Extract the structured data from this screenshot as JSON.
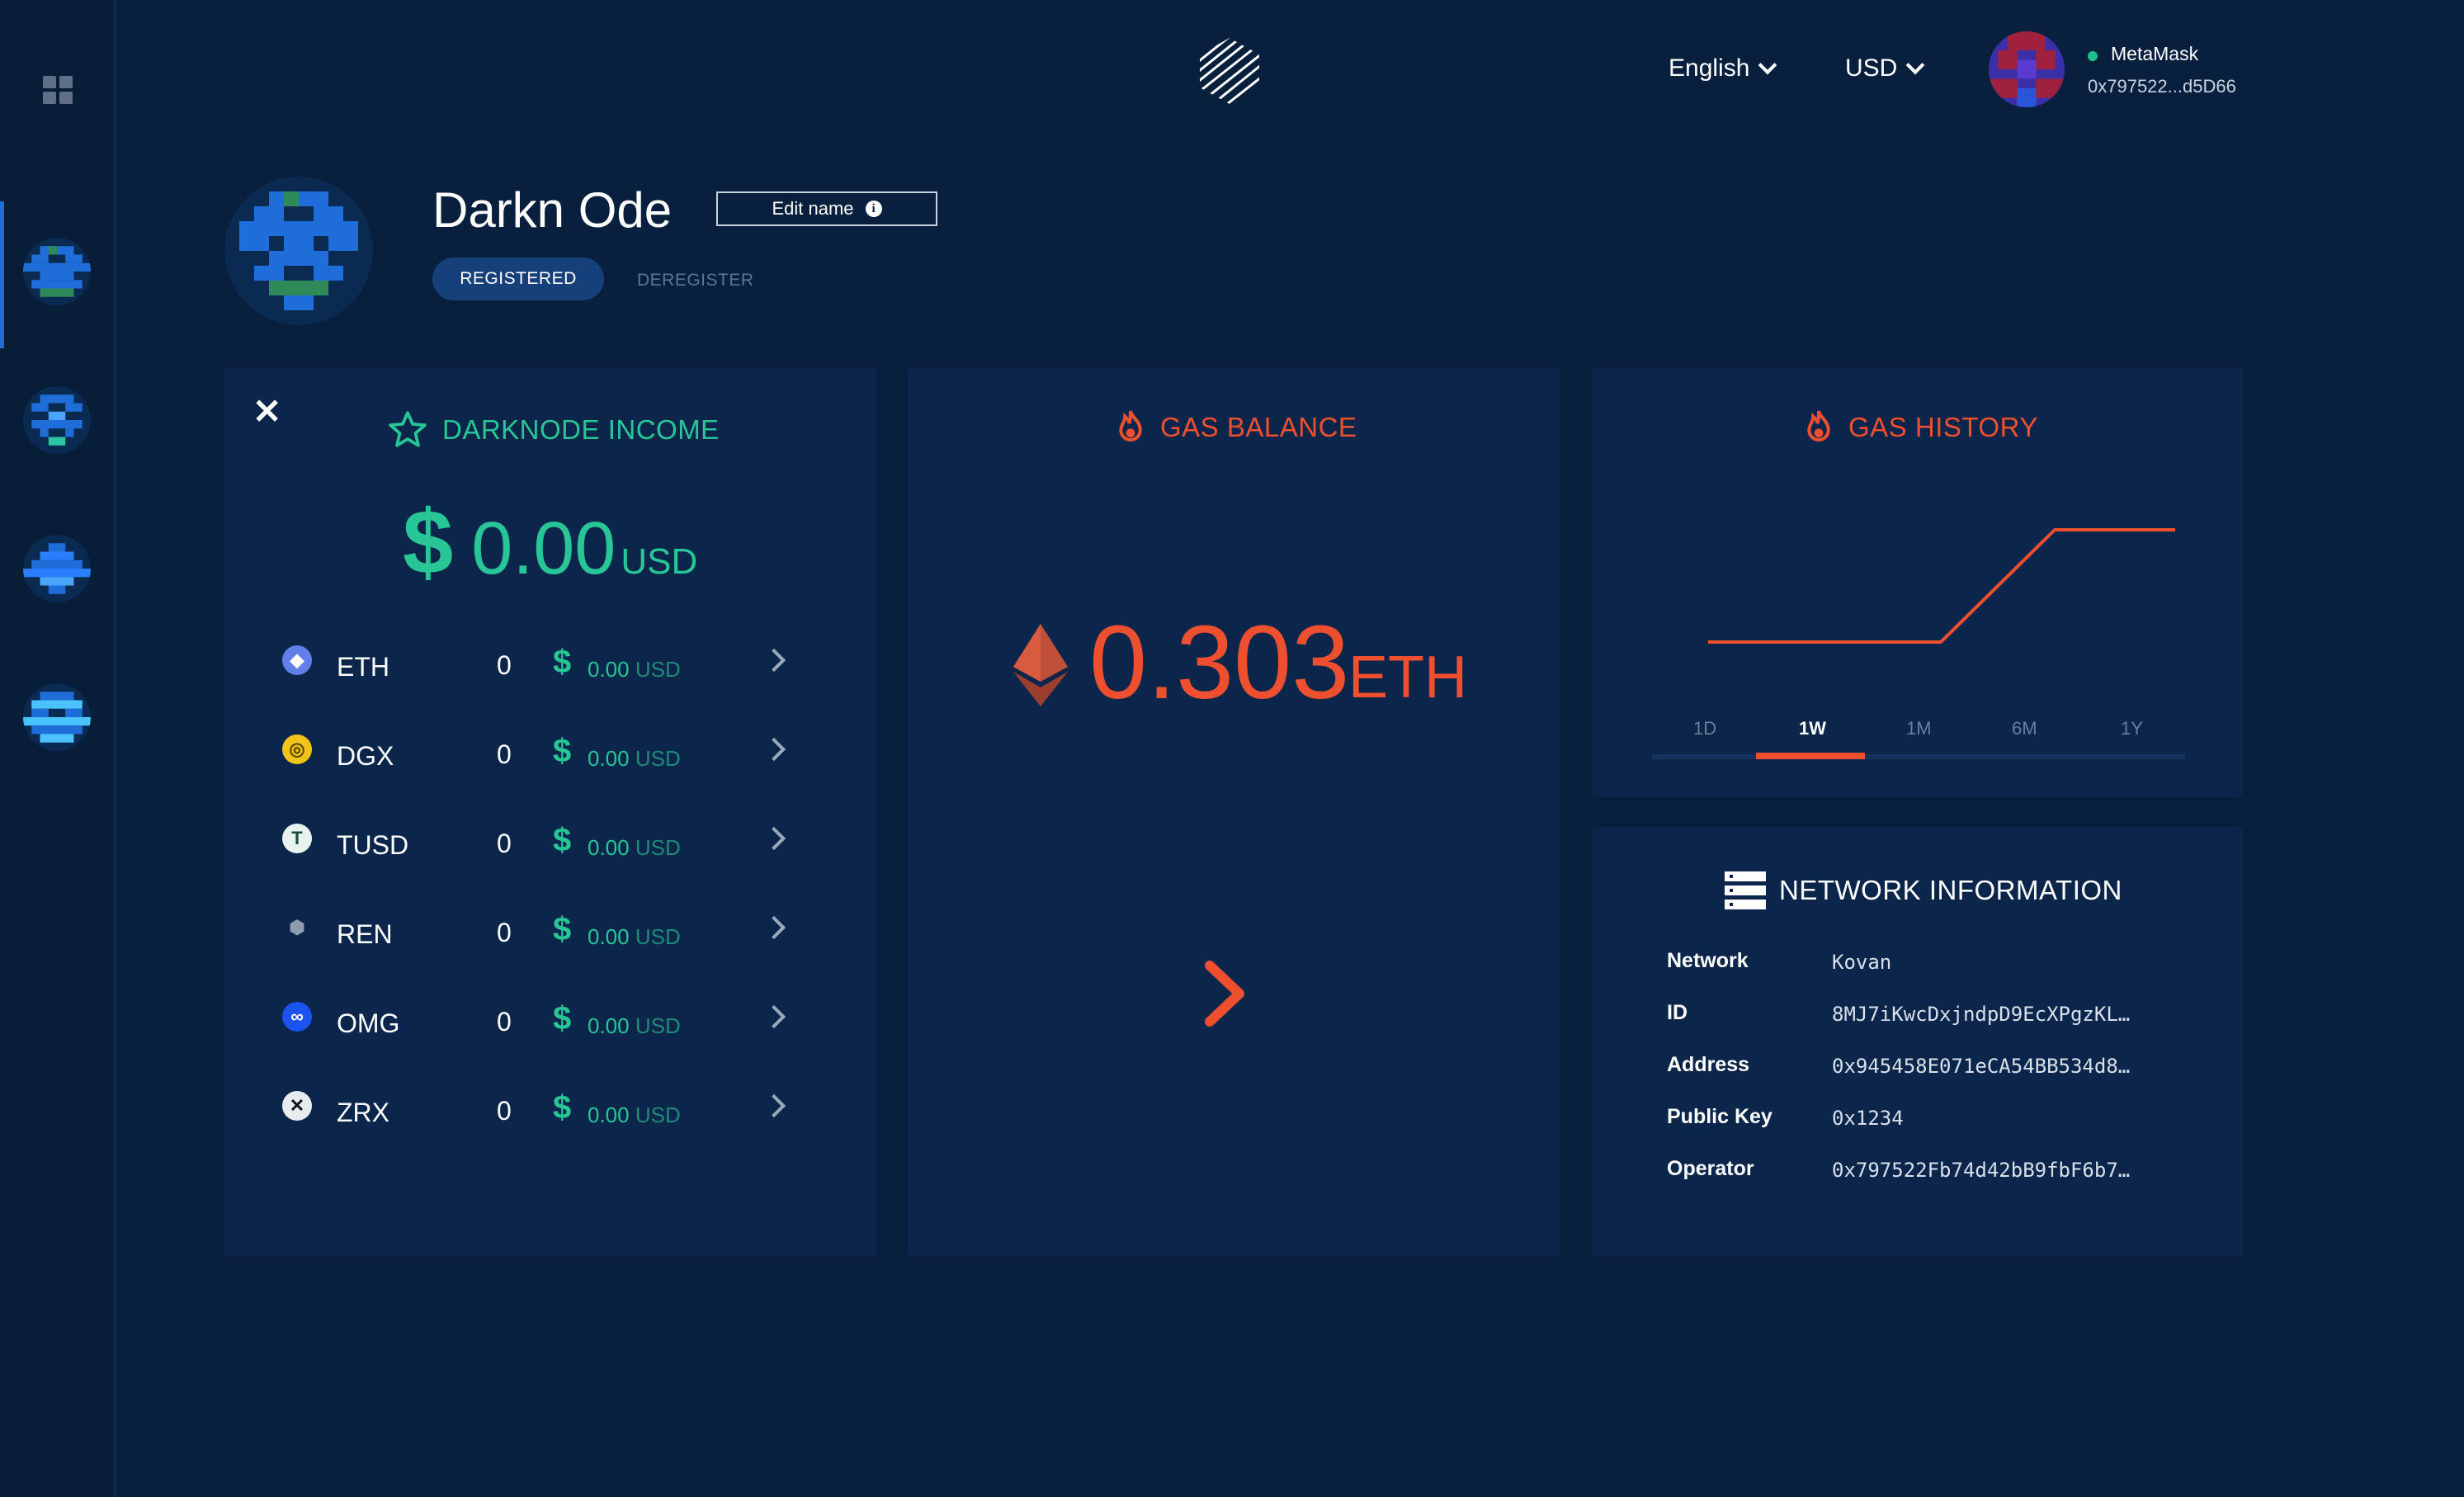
{
  "header": {
    "language": "English",
    "currency": "USD",
    "wallet": {
      "provider": "MetaMask",
      "address": "0x797522...d5D66"
    }
  },
  "darknode": {
    "name": "Darkn Ode",
    "edit_label": "Edit name",
    "info_glyph": "i",
    "registered_label": "REGISTERED",
    "deregister_label": "DEREGISTER"
  },
  "income": {
    "close_glyph": "✕",
    "title": "DARKNODE INCOME",
    "total_symbol": "$",
    "total_value": "0.00",
    "total_currency": "USD",
    "tokens": [
      {
        "symbol": "ETH",
        "amount": "0",
        "usd_symbol": "$",
        "usd_value": "0.00",
        "usd_label": "USD",
        "icon": "eth-icon"
      },
      {
        "symbol": "DGX",
        "amount": "0",
        "usd_symbol": "$",
        "usd_value": "0.00",
        "usd_label": "USD",
        "icon": "dgx-icon"
      },
      {
        "symbol": "TUSD",
        "amount": "0",
        "usd_symbol": "$",
        "usd_value": "0.00",
        "usd_label": "USD",
        "icon": "tusd-icon"
      },
      {
        "symbol": "REN",
        "amount": "0",
        "usd_symbol": "$",
        "usd_value": "0.00",
        "usd_label": "USD",
        "icon": "ren-icon"
      },
      {
        "symbol": "OMG",
        "amount": "0",
        "usd_symbol": "$",
        "usd_value": "0.00",
        "usd_label": "USD",
        "icon": "omg-icon"
      },
      {
        "symbol": "ZRX",
        "amount": "0",
        "usd_symbol": "$",
        "usd_value": "0.00",
        "usd_label": "USD",
        "icon": "zrx-icon"
      }
    ]
  },
  "gas_balance": {
    "title": "GAS BALANCE",
    "value": "0.303",
    "currency": "ETH"
  },
  "gas_history": {
    "title": "GAS HISTORY",
    "timeframes": [
      "1D",
      "1W",
      "1M",
      "6M",
      "1Y"
    ],
    "selected": "1W"
  },
  "network": {
    "title": "NETWORK INFORMATION",
    "rows": [
      {
        "label": "Network",
        "value": "Kovan"
      },
      {
        "label": "ID",
        "value": "8MJ7iKwcDxjndpD9EcXPgzKL…"
      },
      {
        "label": "Address",
        "value": "0x945458E071eCA54BB534d8…"
      },
      {
        "label": "Public Key",
        "value": "0x1234"
      },
      {
        "label": "Operator",
        "value": "0x797522Fb74d42bB9fbF6b7…"
      }
    ]
  },
  "colors": {
    "accent_green": "#28c696",
    "accent_red": "#ee4f2f",
    "background": "#081f3d",
    "card": "#0b264a",
    "pill": "#164079"
  }
}
